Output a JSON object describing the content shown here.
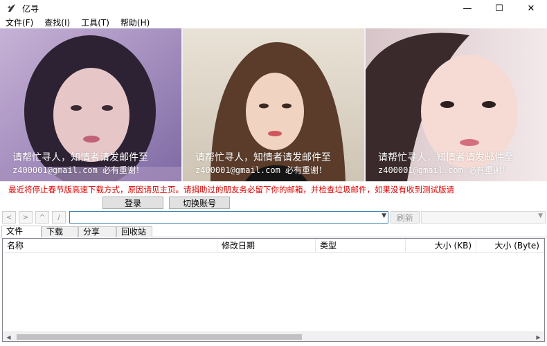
{
  "window": {
    "title": "亿寻",
    "minimize": "—",
    "maximize": "☐",
    "close": "✕"
  },
  "menu": [
    "文件(F)",
    "查找(I)",
    "工具(T)",
    "帮助(H)"
  ],
  "banner": {
    "panels": [
      {
        "line1": "请帮忙寻人，知情者请发邮件至",
        "line2": "z400001@gmail.com 必有重谢！"
      },
      {
        "line1": "请帮忙寻人，知情者请发邮件至",
        "line2": "z400001@gmail.com 必有重谢！"
      },
      {
        "line1": "请帮忙寻人，知情者请发邮件至",
        "line2": "z400001@gmail.com 必有重谢！"
      }
    ]
  },
  "notice": "最近将停止春节版高速下载方式，原因请见主页。请捐助过的朋友务必留下你的邮箱，并检查垃圾邮件，如果没有收到测试版请",
  "login": {
    "login_label": "登录",
    "switch_label": "切换账号"
  },
  "nav": {
    "back": "<",
    "forward": ">",
    "up": "^",
    "root": "/",
    "path_value": "",
    "refresh_label": "刷新"
  },
  "tabs": [
    "文件",
    "下载",
    "分享",
    "回收站"
  ],
  "table": {
    "columns": [
      "名称",
      "修改日期",
      "类型",
      "大小 (KB)",
      "大小 (Byte)"
    ],
    "rows": []
  },
  "colors": {
    "notice": "#e00000",
    "path_border": "#3c7fb1"
  }
}
